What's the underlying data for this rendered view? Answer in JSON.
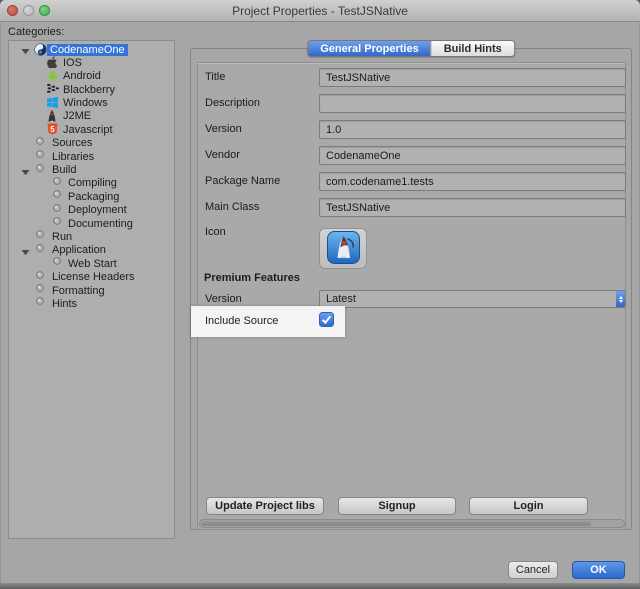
{
  "window": {
    "title": "Project Properties - TestJSNative",
    "traffic_lights": [
      "close",
      "minimize",
      "zoom"
    ]
  },
  "categories": {
    "label": "Categories:",
    "items": [
      {
        "label": "CodenameOne",
        "icon": "codenameone-icon",
        "depth": 0,
        "arrow": true,
        "big": true,
        "selected": true
      },
      {
        "label": "IOS",
        "icon": "apple-icon",
        "depth": 1,
        "arrow": false,
        "big": true,
        "selected": false
      },
      {
        "label": "Android",
        "icon": "android-icon",
        "depth": 1,
        "arrow": false,
        "big": true,
        "selected": false
      },
      {
        "label": "Blackberry",
        "icon": "blackberry-icon",
        "depth": 1,
        "arrow": false,
        "big": true,
        "selected": false
      },
      {
        "label": "Windows",
        "icon": "windows-icon",
        "depth": 1,
        "arrow": false,
        "big": true,
        "selected": false
      },
      {
        "label": "J2ME",
        "icon": "j2me-icon",
        "depth": 1,
        "arrow": false,
        "big": true,
        "selected": false
      },
      {
        "label": "Javascript",
        "icon": "javascript-icon",
        "depth": 1,
        "arrow": false,
        "big": true,
        "selected": false
      },
      {
        "label": "Sources",
        "icon": "node-icon",
        "depth": 0,
        "arrow": false,
        "big": false,
        "selected": false
      },
      {
        "label": "Libraries",
        "icon": "node-icon",
        "depth": 0,
        "arrow": false,
        "big": false,
        "selected": false
      },
      {
        "label": "Build",
        "icon": "node-icon",
        "depth": 0,
        "arrow": true,
        "big": false,
        "selected": false
      },
      {
        "label": "Compiling",
        "icon": "node-icon",
        "depth": 1,
        "arrow": false,
        "big": false,
        "selected": false
      },
      {
        "label": "Packaging",
        "icon": "node-icon",
        "depth": 1,
        "arrow": false,
        "big": false,
        "selected": false
      },
      {
        "label": "Deployment",
        "icon": "node-icon",
        "depth": 1,
        "arrow": false,
        "big": false,
        "selected": false
      },
      {
        "label": "Documenting",
        "icon": "node-icon",
        "depth": 1,
        "arrow": false,
        "big": false,
        "selected": false
      },
      {
        "label": "Run",
        "icon": "node-icon",
        "depth": 0,
        "arrow": false,
        "big": false,
        "selected": false
      },
      {
        "label": "Application",
        "icon": "node-icon",
        "depth": 0,
        "arrow": true,
        "big": false,
        "selected": false
      },
      {
        "label": "Web Start",
        "icon": "node-icon",
        "depth": 1,
        "arrow": false,
        "big": false,
        "selected": false
      },
      {
        "label": "License Headers",
        "icon": "node-icon",
        "depth": 0,
        "arrow": false,
        "big": false,
        "selected": false
      },
      {
        "label": "Formatting",
        "icon": "node-icon",
        "depth": 0,
        "arrow": false,
        "big": false,
        "selected": false
      },
      {
        "label": "Hints",
        "icon": "node-icon",
        "depth": 0,
        "arrow": false,
        "big": false,
        "selected": false
      }
    ]
  },
  "tabs": [
    {
      "label": "General Properties",
      "selected": true
    },
    {
      "label": "Build Hints",
      "selected": false
    }
  ],
  "form": {
    "fields": [
      {
        "label": "Title",
        "value": "TestJSNative"
      },
      {
        "label": "Description",
        "value": ""
      },
      {
        "label": "Version",
        "value": "1.0"
      },
      {
        "label": "Vendor",
        "value": "CodenameOne"
      },
      {
        "label": "Package Name",
        "value": "com.codename1.tests"
      },
      {
        "label": "Main Class",
        "value": "TestJSNative"
      }
    ],
    "icon_row": {
      "label": "Icon",
      "icon": "duke-app-icon"
    },
    "premium": {
      "header": "Premium Features",
      "version_label": "Version",
      "version_value": "Latest",
      "include_source_label": "Include Source",
      "include_source_checked": true
    }
  },
  "panel_buttons": [
    {
      "label": "Update Project libs"
    },
    {
      "label": "Signup"
    },
    {
      "label": "Login"
    }
  ],
  "dialog_buttons": {
    "cancel": "Cancel",
    "ok": "OK"
  },
  "colors": {
    "selection_blue": "#3574d4",
    "tab_blue": "#3168ca",
    "checkbox_blue": "#3f82e0",
    "ok_blue": "#2c68cd",
    "highlight_white": "#f4f4f4",
    "window_gray": "#a6a6a6"
  }
}
